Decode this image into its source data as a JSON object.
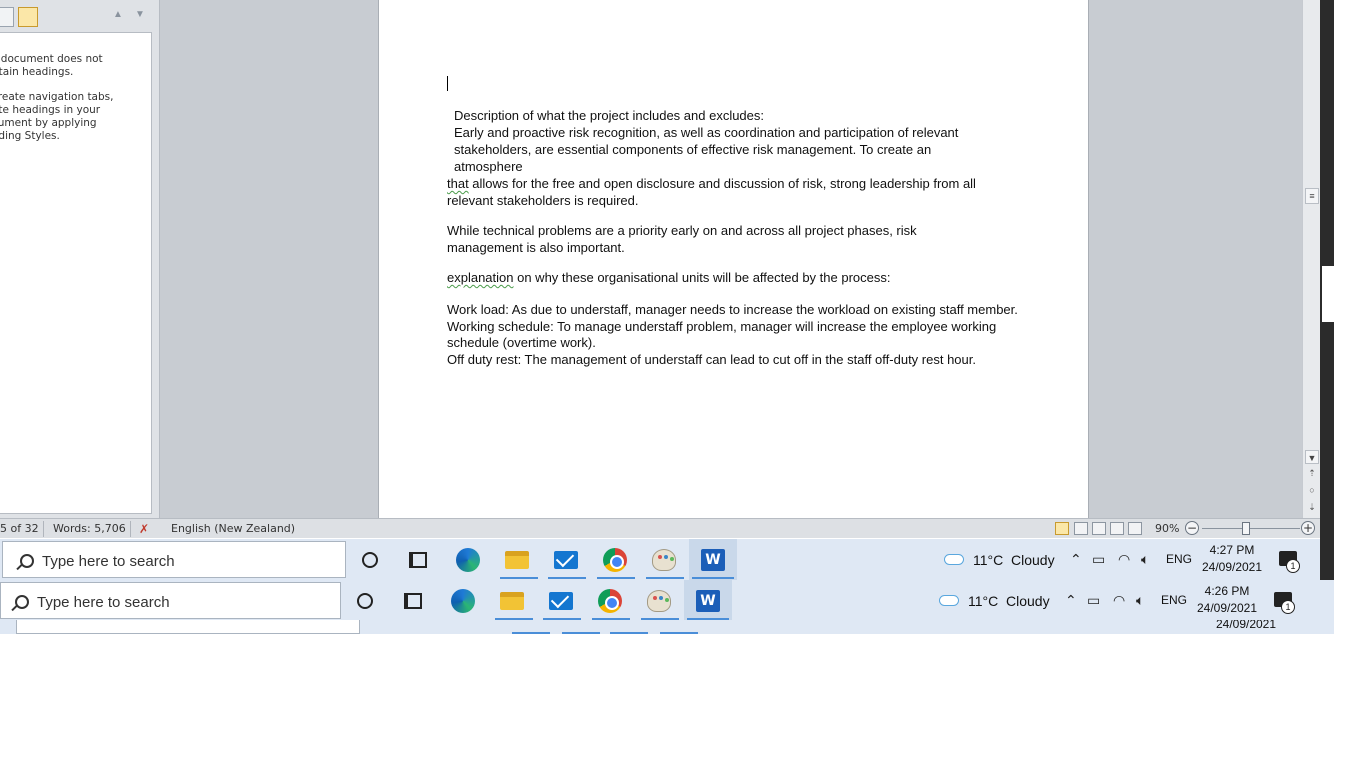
{
  "nav_pane": {
    "message1": "s document does not\nntain headings.",
    "message2": "create navigation tabs,\nate headings in your\ncument by applying\nading Styles."
  },
  "document": {
    "p1": "Description of what the project includes and excludes:",
    "p2": "Early and proactive risk recognition, as well as coordination and participation of relevant stakeholders, are essential components of effective risk management.  To create an atmosphere",
    "p3_squig": "that",
    "p3": " allows for the free and open disclosure and discussion of risk, strong leadership from all relevant stakeholders is required.",
    "p4": "While technical problems are a priority early on and across all project phases, risk management  is also important.",
    "p5_squig": "explanation",
    "p5": " on why these organisational units will be affected by the process:",
    "p6": "Work load:  As due to understaff, manager needs to increase the workload on existing staff member.",
    "p7": "Working schedule: To manage  understaff problem, manager will increase the employee working schedule (overtime work).",
    "p8": "Off duty rest: The management  of understaff can lead to cut off in the staff off-duty rest hour."
  },
  "status_bar": {
    "page": "5 of 32",
    "words": "Words: 5,706",
    "language": "English (New Zealand)",
    "zoom": "90%",
    "zoom_level_percent": 90
  },
  "taskbar1": {
    "search_placeholder": "Type here to search",
    "temperature": "11°C",
    "weather": "Cloudy",
    "lang": "ENG",
    "time": "4:27 PM",
    "date": "24/09/2021",
    "notif_count": "1"
  },
  "taskbar2": {
    "search_placeholder": "Type here to search",
    "temperature": "11°C",
    "weather": "Cloudy",
    "lang": "ENG",
    "time": "4:26 PM",
    "date": "24/09/2021",
    "notif_count": "1"
  },
  "taskbar3": {
    "date": "24/09/2021"
  },
  "colors": {
    "accent": "#1b5eb8",
    "taskbar": "#dfe8f4",
    "doc_bg": "#c8ccd2"
  }
}
